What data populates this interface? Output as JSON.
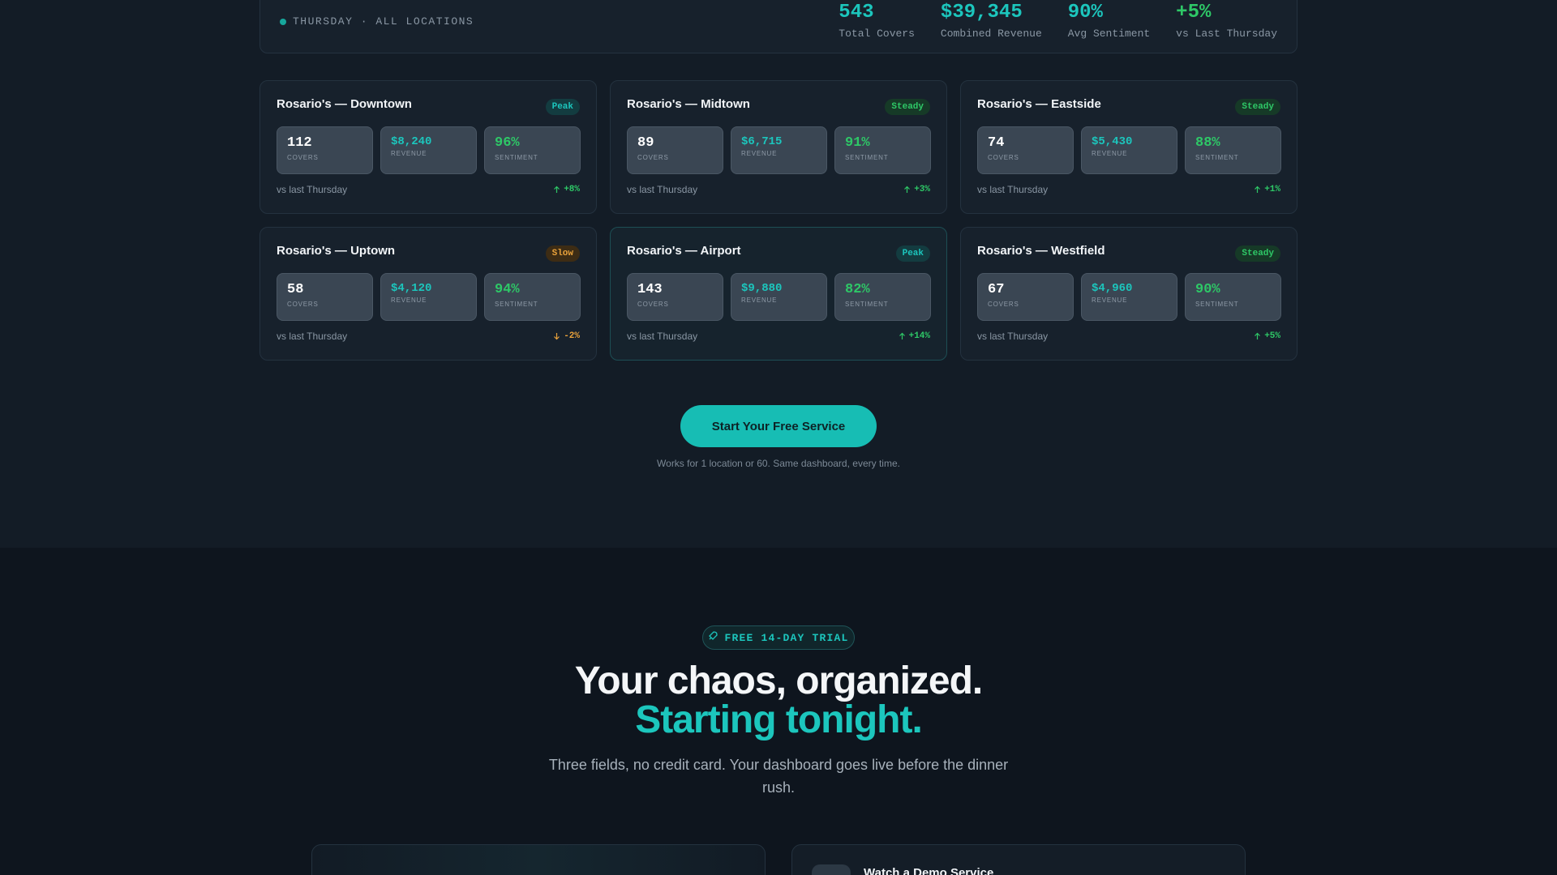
{
  "summary": {
    "label": "THURSDAY · ALL LOCATIONS",
    "stats": [
      {
        "value": "543",
        "label": "Total Covers"
      },
      {
        "value": "$39,345",
        "label": "Combined Revenue"
      },
      {
        "value": "90%",
        "label": "Avg Sentiment"
      },
      {
        "value": "+5%",
        "label": "vs Last Thursday"
      }
    ]
  },
  "metric_labels": {
    "covers": "COVERS",
    "revenue": "REVENUE",
    "sentiment": "SENTIMENT"
  },
  "locations": [
    {
      "name": "Rosario's — Downtown",
      "status": "Peak",
      "covers": "112",
      "revenue": "$8,240",
      "sentiment": "96%",
      "compare": "vs last Thursday",
      "delta": "+8%",
      "direction": "up"
    },
    {
      "name": "Rosario's — Midtown",
      "status": "Steady",
      "covers": "89",
      "revenue": "$6,715",
      "sentiment": "91%",
      "compare": "vs last Thursday",
      "delta": "+3%",
      "direction": "up"
    },
    {
      "name": "Rosario's — Eastside",
      "status": "Steady",
      "covers": "74",
      "revenue": "$5,430",
      "sentiment": "88%",
      "compare": "vs last Thursday",
      "delta": "+1%",
      "direction": "up"
    },
    {
      "name": "Rosario's — Uptown",
      "status": "Slow",
      "covers": "58",
      "revenue": "$4,120",
      "sentiment": "94%",
      "compare": "vs last Thursday",
      "delta": "-2%",
      "direction": "down"
    },
    {
      "name": "Rosario's — Airport",
      "status": "Peak",
      "covers": "143",
      "revenue": "$9,880",
      "sentiment": "82%",
      "compare": "vs last Thursday",
      "delta": "+14%",
      "direction": "up"
    },
    {
      "name": "Rosario's — Westfield",
      "status": "Steady",
      "covers": "67",
      "revenue": "$4,960",
      "sentiment": "90%",
      "compare": "vs last Thursday",
      "delta": "+5%",
      "direction": "up"
    }
  ],
  "cta": {
    "button_label": "Start Your Free Service",
    "note": "Works for 1 location or 60. Same dashboard, every time."
  },
  "trial": {
    "badge": "FREE 14-DAY TRIAL",
    "badge_icon": "rocket-icon",
    "headline_line1": "Your chaos, organized.",
    "headline_line2": "Starting tonight.",
    "subcopy": "Three fields, no credit card. Your dashboard goes live before the dinner rush."
  },
  "demo": {
    "title": "Watch a Demo Service"
  },
  "colors": {
    "accent": "#1cc6bd",
    "positive": "#2ec867",
    "warning": "#e9a23b",
    "background": "#131c26"
  }
}
